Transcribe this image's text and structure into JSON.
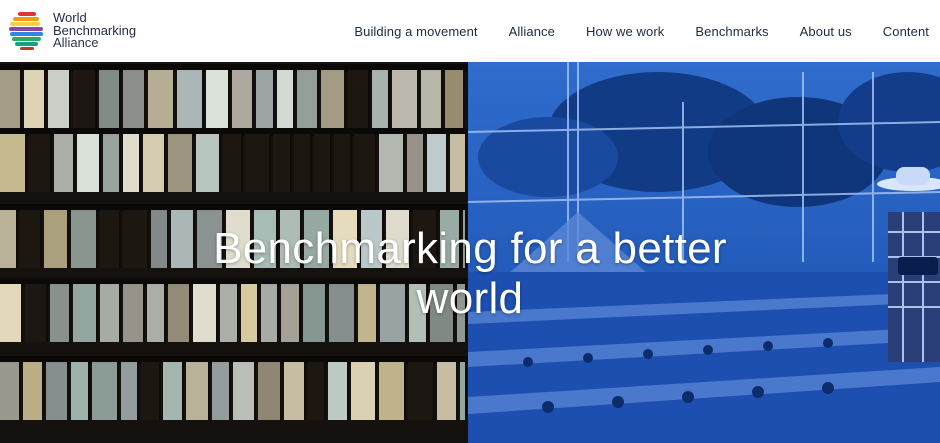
{
  "brand": {
    "line1": "World",
    "line2": "Benchmarking",
    "line3": "Alliance",
    "colors": [
      "#e3342f",
      "#f39c12",
      "#f7d046",
      "#8e44ad",
      "#2e86de",
      "#27ae60",
      "#16a085",
      "#c0392b"
    ]
  },
  "nav": {
    "items": [
      {
        "label": "Building a movement"
      },
      {
        "label": "Alliance"
      },
      {
        "label": "How we work"
      },
      {
        "label": "Benchmarks"
      },
      {
        "label": "About us"
      },
      {
        "label": "Content"
      }
    ]
  },
  "hero": {
    "title_line1": "Benchmarking for a better",
    "title_line2": "world",
    "left_tint": "#15110f",
    "right_tint": "#1d56b8"
  }
}
